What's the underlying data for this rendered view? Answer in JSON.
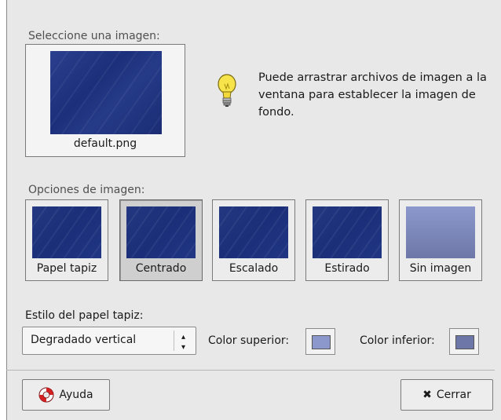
{
  "labels": {
    "select_image": "Seleccione una imagen:",
    "image_options": "Opciones de imagen:",
    "wallpaper_style": "Estilo del papel tapiz:",
    "color_top": "Color superior:",
    "color_bottom": "Color inferior:"
  },
  "preview": {
    "filename": "default.png"
  },
  "hint": {
    "text": "Puede arrastrar archivos de imagen a la ventana para establecer la imagen de fondo."
  },
  "options": [
    {
      "label": "Papel tapiz",
      "selected": false
    },
    {
      "label": "Centrado",
      "selected": true
    },
    {
      "label": "Escalado",
      "selected": false
    },
    {
      "label": "Estirado",
      "selected": false
    },
    {
      "label": "Sin imagen",
      "selected": false
    }
  ],
  "style_combo": {
    "value": "Degradado vertical"
  },
  "colors": {
    "top": "#8c98cc",
    "bottom": "#6e78a8"
  },
  "buttons": {
    "help": "Ayuda",
    "close": "Cerrar"
  },
  "icons": {
    "hint": "lightbulb-icon",
    "help": "lifebuoy-icon",
    "close": "close-icon"
  }
}
